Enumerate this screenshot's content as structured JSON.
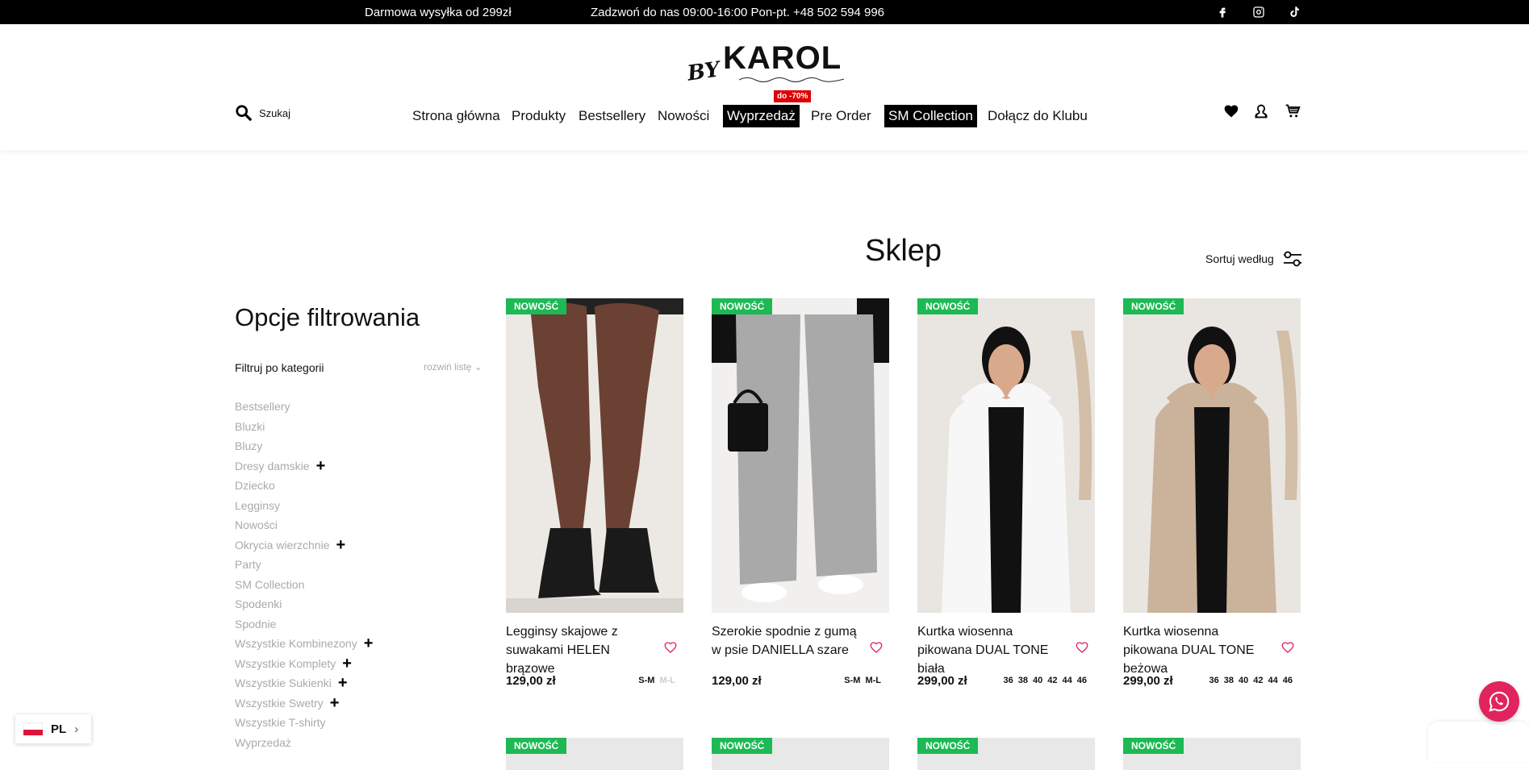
{
  "topbar": {
    "shipping": "Darmowa wysyłka od 299zł",
    "call": "Zadzwoń do nas 09:00-16:00 Pon-pt. +48 502 594 996",
    "social": [
      "facebook-icon",
      "instagram-icon",
      "tiktok-icon"
    ]
  },
  "header": {
    "logo_by": "BY",
    "logo_name": "KAROL",
    "search_placeholder": "Szukaj",
    "nav": [
      {
        "label": "Strona główna"
      },
      {
        "label": "Produkty"
      },
      {
        "label": "Bestsellery"
      },
      {
        "label": "Nowości"
      },
      {
        "label": "Wyprzedaż",
        "badge": "do -70%"
      },
      {
        "label": "Pre Order"
      },
      {
        "label": "SM Collection"
      },
      {
        "label": "Dołącz do Klubu"
      }
    ],
    "icons": [
      "heart-icon",
      "account-icon",
      "cart-icon"
    ]
  },
  "main": {
    "title": "Sklep",
    "sort_label": "Sortuj według"
  },
  "filters": {
    "title": "Opcje filtrowania",
    "by_category": "Filtruj po kategorii",
    "expand": "rozwiń listę",
    "categories": [
      {
        "label": "Bestsellery",
        "expandable": false
      },
      {
        "label": "Bluzki",
        "expandable": false
      },
      {
        "label": "Bluzy",
        "expandable": false
      },
      {
        "label": "Dresy damskie",
        "expandable": true
      },
      {
        "label": "Dziecko",
        "expandable": false
      },
      {
        "label": "Legginsy",
        "expandable": false
      },
      {
        "label": "Nowości",
        "expandable": false
      },
      {
        "label": "Okrycia wierzchnie",
        "expandable": true
      },
      {
        "label": "Party",
        "expandable": false
      },
      {
        "label": "SM Collection",
        "expandable": false
      },
      {
        "label": "Spodenki",
        "expandable": false
      },
      {
        "label": "Spodnie",
        "expandable": false
      },
      {
        "label": "Wszystkie Kombinezony",
        "expandable": true
      },
      {
        "label": "Wszystkie Komplety",
        "expandable": true
      },
      {
        "label": "Wszystkie Sukienki",
        "expandable": true
      },
      {
        "label": "Wszystkie Swetry",
        "expandable": true
      },
      {
        "label": "Wszystkie T-shirty",
        "expandable": false
      },
      {
        "label": "Wyprzedaż",
        "expandable": false
      }
    ]
  },
  "products": [
    {
      "badge": "NOWOŚĆ",
      "name": "Legginsy skajowe z suwakami HELEN brązowe",
      "price": "129,00 zł",
      "sizes": [
        {
          "s": "S-M",
          "available": true
        },
        {
          "s": "M-L",
          "available": false
        }
      ],
      "colors": {
        "bg": "#ece9e4",
        "main": "#6b4133",
        "accent": "#1a1a1a"
      }
    },
    {
      "badge": "NOWOŚĆ",
      "name": "Szerokie spodnie z gumą w psie DANIELLA szare",
      "price": "129,00 zł",
      "sizes": [
        {
          "s": "S-M",
          "available": true
        },
        {
          "s": "M-L",
          "available": true
        }
      ],
      "colors": {
        "bg": "#f1f0ee",
        "main": "#a9a9a9",
        "accent": "#1a1a1a"
      }
    },
    {
      "badge": "NOWOŚĆ",
      "name": "Kurtka wiosenna pikowana DUAL TONE biała",
      "price": "299,00 zł",
      "sizes": [
        {
          "s": "36",
          "available": true
        },
        {
          "s": "38",
          "available": true
        },
        {
          "s": "40",
          "available": true
        },
        {
          "s": "42",
          "available": true
        },
        {
          "s": "44",
          "available": true
        },
        {
          "s": "46",
          "available": true
        }
      ],
      "colors": {
        "bg": "#e9e6e2",
        "main": "#f7f7f7",
        "accent": "#c9ad8e"
      }
    },
    {
      "badge": "NOWOŚĆ",
      "name": "Kurtka wiosenna pikowana DUAL TONE beżowa",
      "price": "299,00 zł",
      "sizes": [
        {
          "s": "36",
          "available": true
        },
        {
          "s": "38",
          "available": true
        },
        {
          "s": "40",
          "available": true
        },
        {
          "s": "42",
          "available": true
        },
        {
          "s": "44",
          "available": true
        },
        {
          "s": "46",
          "available": true
        }
      ],
      "colors": {
        "bg": "#e9e6e2",
        "main": "#cbb29a",
        "accent": "#c9ad8e"
      }
    }
  ],
  "next_row_badges": [
    "NOWOŚĆ",
    "NOWOŚĆ",
    "NOWOŚĆ",
    "NOWOŚĆ"
  ],
  "language": {
    "code": "PL"
  },
  "colors": {
    "badge_new": "#1db954",
    "sale_badge": "#dd0000",
    "whatsapp": "#e0245e"
  }
}
